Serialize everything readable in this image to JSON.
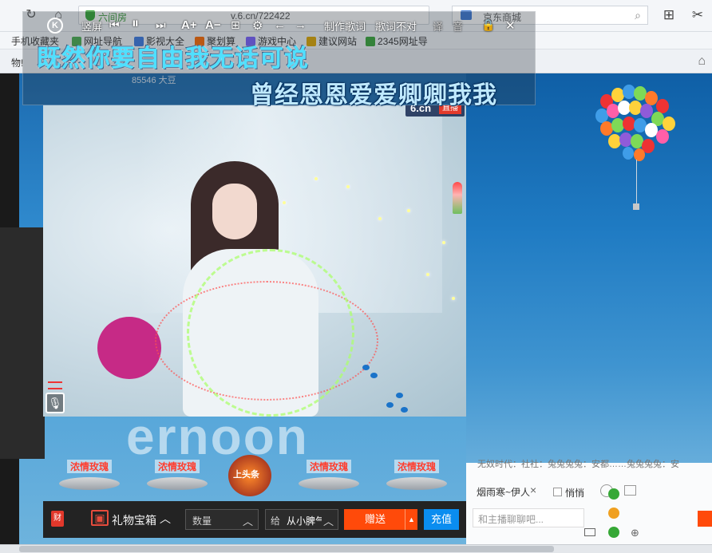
{
  "browser": {
    "address_site": "六间房",
    "address_url": "v.6.cn/722422",
    "search_placeholder": "京东商城",
    "tab_partial": "物!"
  },
  "bookmarks": [
    {
      "label": "手机收藏夹",
      "icon": "folder-icon",
      "color": "#f0c24b"
    },
    {
      "label": "网址导航",
      "icon": "leaf-icon",
      "color": "#4caf50"
    },
    {
      "label": "影视大全",
      "icon": "film-icon",
      "color": "#3d7be3"
    },
    {
      "label": "聚划算",
      "icon": "taobao-icon",
      "color": "#ff6a00"
    },
    {
      "label": "游戏中心",
      "icon": "gamepad-icon",
      "color": "#7b61ff"
    },
    {
      "label": "建议网站",
      "icon": "star-icon",
      "color": "#e0a800"
    },
    {
      "label": "2345网址导",
      "icon": "house-icon",
      "color": "#3aa83a"
    }
  ],
  "page_behind": {
    "fans_text": "85546 大豆",
    "bg_watermark": "ernoon"
  },
  "lyric_toolbar": {
    "portrait_label": "竖屏",
    "make_lyric_label": "制作歌词",
    "lyric_mismatch_label": "歌词不对",
    "translate_label": "译",
    "pinyin_label": "音",
    "line1": "既然你要自由我无话可说",
    "line2": "曾经恩恩爱爱卿卿我我"
  },
  "video": {
    "logo_text": "6.cn",
    "live_badge": "直播"
  },
  "gifts": [
    {
      "label": "浓情玫瑰"
    },
    {
      "label": "浓情玫瑰"
    },
    {
      "label": "上头条"
    },
    {
      "label": "浓情玫瑰"
    },
    {
      "label": "浓情玫瑰"
    }
  ],
  "bottom_bar": {
    "wealth_label": "财",
    "gift_box_label": "礼物宝箱",
    "quantity_label": "数量",
    "recipient_prefix": "给",
    "recipient_name": "从小脾气",
    "send_label": "赠送",
    "recharge_label": "充值"
  },
  "chat": {
    "marquee": "无奴时代：社社：兔兔兔兔：安都……兔兔兔兔：安",
    "target": "烟雨寒~伊人",
    "quiet_label": "悄悄",
    "input_placeholder": "和主播聊聊吧..."
  },
  "colors": {
    "accent_orange": "#ff4a0a",
    "accent_blue": "#0a8df0",
    "lyric_cyan": "#4fe0ff",
    "status_green": "#36a836"
  }
}
